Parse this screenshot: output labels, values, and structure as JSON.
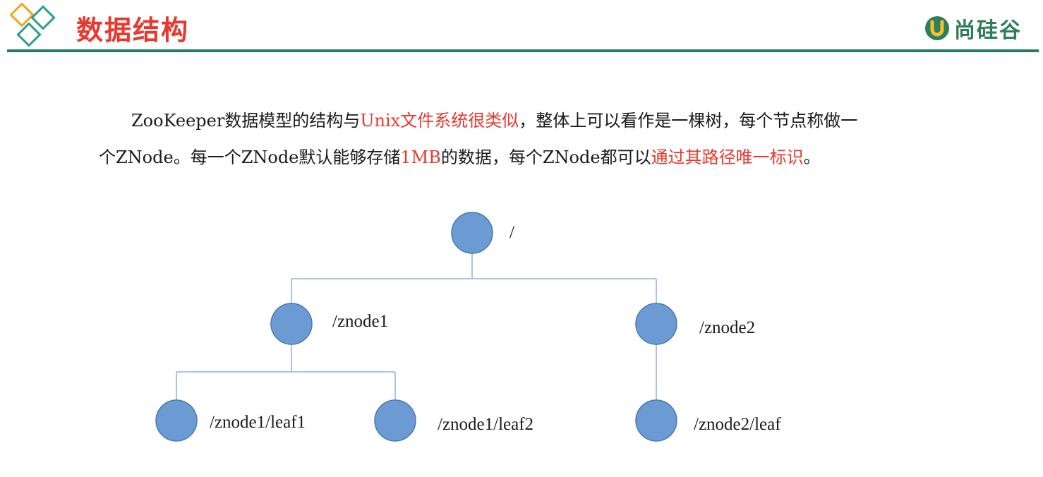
{
  "header": {
    "title": "数据结构",
    "brand": "尚硅谷",
    "colors": {
      "title": "#e8382e",
      "rule": "#2a7a62",
      "brand": "#2e7d5b",
      "diamond_orange": "#f2a51f",
      "diamond_teal": "#2aa08a"
    }
  },
  "intro": {
    "line1": {
      "a": "ZooKeeper数据模型的结构与",
      "b": "Unix文件系统很类似",
      "c": "，整体上可以看作是一棵树，每个节点称做一"
    },
    "line2": {
      "a": "个ZNode。每一个ZNode默认能够存储",
      "b": "1MB",
      "c": "的数据，每个ZNode都可以",
      "d": "通过其路径唯一标识",
      "e": "。"
    },
    "highlight_color": "#e8382e"
  },
  "tree": {
    "node_color": "#6b9bd2",
    "edge_color": "#8fb0d8",
    "nodes": {
      "root": "/",
      "znode1": "/znode1",
      "znode2": "/znode2",
      "leaf1": "/znode1/leaf1",
      "leaf2": "/znode1/leaf2",
      "znode2_leaf": "/znode2/leaf"
    }
  }
}
